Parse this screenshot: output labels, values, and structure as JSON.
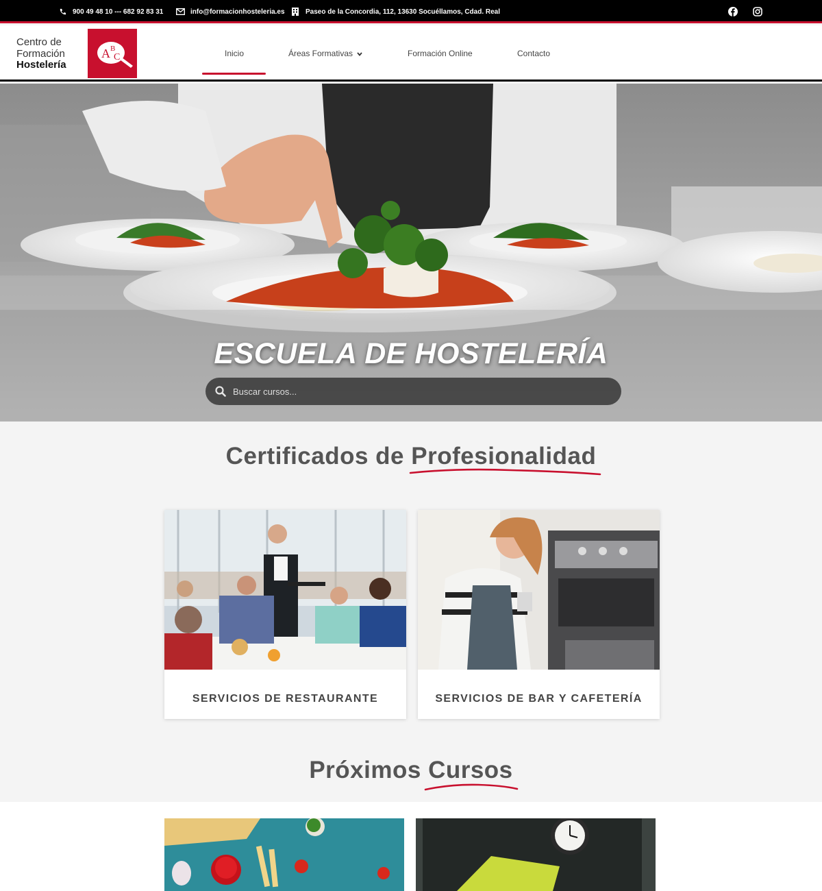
{
  "topbar": {
    "phone": "900 49 48 10 --- 682 92 83 31",
    "email": "info@formacionhosteleria.es",
    "address": "Paseo de la Concordia, 112, 13630 Socuéllamos, Cdad. Real",
    "social": [
      "facebook-icon",
      "instagram-icon"
    ]
  },
  "logo": {
    "line1": "Centro de",
    "line2": "Formación",
    "line3": "Hostelería",
    "letters": [
      "A",
      "B",
      "C"
    ]
  },
  "nav": {
    "items": [
      {
        "label": "Inicio",
        "active": true
      },
      {
        "label": "Áreas Formativas",
        "dropdown": true
      },
      {
        "label": "Formación Online"
      },
      {
        "label": "Contacto"
      }
    ]
  },
  "hero": {
    "title": "ESCUELA DE HOSTELERÍA",
    "search_placeholder": "Buscar cursos..."
  },
  "certificados": {
    "title_part1": "Certificados de",
    "title_part2": "Profesionalidad",
    "cards": [
      {
        "label": "SERVICIOS DE RESTAURANTE"
      },
      {
        "label": "SERVICIOS DE BAR Y CAFETERÍA"
      }
    ]
  },
  "proximos": {
    "title_part1": "Próximos",
    "title_part2": "Cursos"
  },
  "colors": {
    "brand": "#c8102e",
    "topbar": "#000000",
    "text": "#555555"
  }
}
